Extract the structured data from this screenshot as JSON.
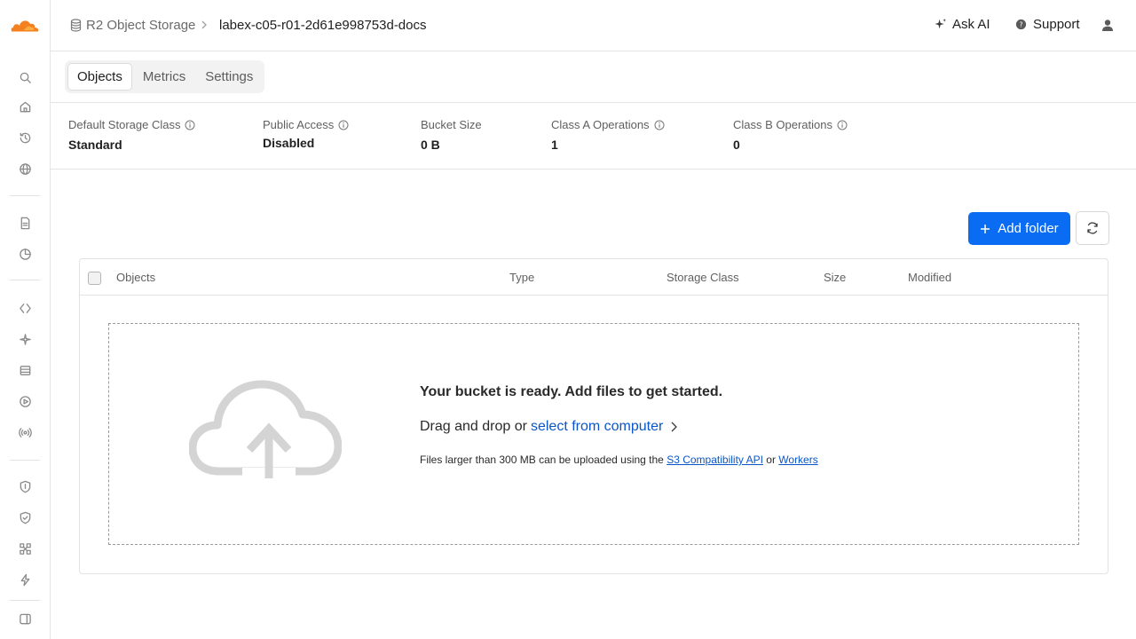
{
  "brand": {
    "logo_icon": "cloudflare-logo-icon",
    "accent": "#f48120"
  },
  "sidebar": {
    "icons": [
      "search-icon",
      "home-icon",
      "history-icon",
      "globe-icon",
      "document-icon",
      "analytics-icon",
      "code-icon",
      "ai-sparkle-icon",
      "storage-icon",
      "play-icon",
      "broadcast-icon",
      "shield-icon",
      "shield-check-icon",
      "network-icon",
      "lightning-icon",
      "collapse-sidebar-icon"
    ]
  },
  "breadcrumb": {
    "root": "R2 Object Storage",
    "current": "labex-c05-r01-2d61e998753d-docs"
  },
  "topbar": {
    "ask_ai": "Ask AI",
    "support": "Support"
  },
  "tabs": [
    {
      "label": "Objects",
      "active": true
    },
    {
      "label": "Metrics",
      "active": false
    },
    {
      "label": "Settings",
      "active": false
    }
  ],
  "stats": {
    "storage_class": {
      "label": "Default Storage Class",
      "value": "Standard"
    },
    "public_access": {
      "label": "Public Access",
      "value": "Disabled"
    },
    "bucket_size": {
      "label": "Bucket Size",
      "value": "0 B"
    },
    "class_a": {
      "label": "Class A Operations",
      "value": "1"
    },
    "class_b": {
      "label": "Class B Operations",
      "value": "0"
    }
  },
  "actions": {
    "add_folder": "Add folder",
    "refresh_icon": "refresh-icon"
  },
  "table": {
    "columns": [
      "Objects",
      "Type",
      "Storage Class",
      "Size",
      "Modified"
    ]
  },
  "empty_state": {
    "title": "Your bucket is ready. Add files to get started.",
    "drag_text": "Drag and drop or",
    "select_link": "select from computer",
    "note_prefix": "Files larger than 300 MB can be uploaded using the",
    "s3_link": "S3 Compatibility API",
    "note_or": "or",
    "workers_link": "Workers"
  },
  "colors": {
    "primary": "#0a6cf2",
    "link": "#0a56c8",
    "border": "#e3e3e3"
  }
}
